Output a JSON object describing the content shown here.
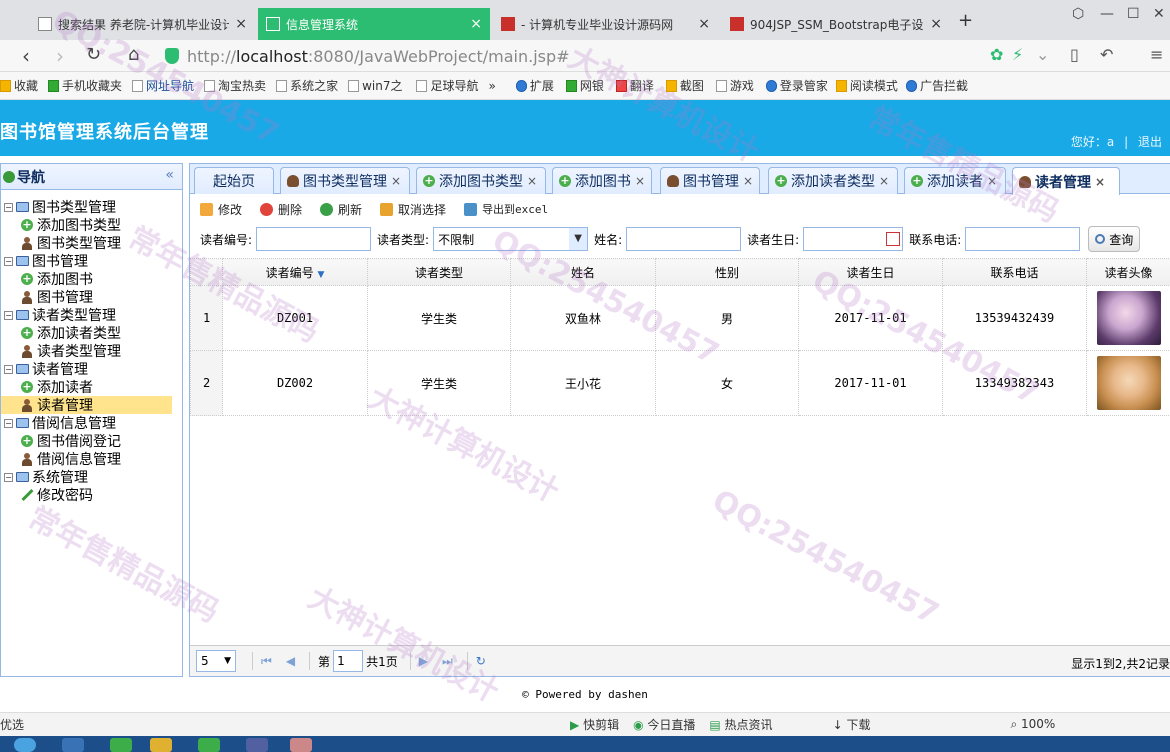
{
  "browser": {
    "tabs": [
      {
        "title": "搜索结果 养老院-计算机毕业设计"
      },
      {
        "title": "信息管理系统"
      },
      {
        "title": "- 计算机专业毕业设计源码网"
      },
      {
        "title": "904JSP_SSM_Bootstrap电子设"
      }
    ],
    "url_prefix": "http://",
    "url_host": "localhost",
    "url_rest": ":8080/JavaWebProject/main.jsp#",
    "bookmarks": [
      "收藏",
      "手机收藏夹",
      "网址导航",
      "淘宝热卖",
      "系统之家",
      "win7之",
      "足球导航",
      "»",
      "扩展",
      "网银",
      "翻译",
      "截图",
      "游戏",
      "登录管家",
      "阅读模式",
      "广告拦截"
    ],
    "status_left": "优选",
    "status_items": [
      "快剪辑",
      "今日直播",
      "热点资讯",
      "下载",
      "100%"
    ]
  },
  "app": {
    "title": "图书馆管理系统后台管理",
    "greeting": "您好：a",
    "logout": "退出"
  },
  "sidebar": {
    "title": "导航",
    "collapse": "«",
    "groups": [
      {
        "label": "图书类型管理",
        "children": [
          "添加图书类型",
          "图书类型管理"
        ]
      },
      {
        "label": "图书管理",
        "children": [
          "添加图书",
          "图书管理"
        ]
      },
      {
        "label": "读者类型管理",
        "children": [
          "添加读者类型",
          "读者类型管理"
        ]
      },
      {
        "label": "读者管理",
        "children": [
          "添加读者",
          "读者管理"
        ]
      },
      {
        "label": "借阅信息管理",
        "children": [
          "图书借阅登记",
          "借阅信息管理"
        ]
      },
      {
        "label": "系统管理",
        "children": [
          "修改密码"
        ]
      }
    ]
  },
  "tabs": [
    "起始页",
    "图书类型管理",
    "添加图书类型",
    "添加图书",
    "图书管理",
    "添加读者类型",
    "添加读者",
    "读者管理"
  ],
  "toolbar": {
    "edit": "修改",
    "delete": "删除",
    "refresh": "刷新",
    "unselect": "取消选择",
    "export": "导出到excel"
  },
  "search": {
    "reader_no_label": "读者编号:",
    "reader_type_label": "读者类型:",
    "reader_type_value": "不限制",
    "name_label": "姓名:",
    "birthday_label": "读者生日:",
    "phone_label": "联系电话:",
    "query_button": "查询"
  },
  "grid": {
    "columns": [
      "读者编号",
      "读者类型",
      "姓名",
      "性别",
      "读者生日",
      "联系电话",
      "读者头像"
    ],
    "sort_arrow": "▼",
    "rows": [
      {
        "rownum": "1",
        "no": "DZ001",
        "type": "学生类",
        "name": "双鱼林",
        "sex": "男",
        "birthday": "2017-11-01",
        "phone": "13539432439"
      },
      {
        "rownum": "2",
        "no": "DZ002",
        "type": "学生类",
        "name": "王小花",
        "sex": "女",
        "birthday": "2017-11-01",
        "phone": "13349382343"
      }
    ]
  },
  "pager": {
    "page_size": "5",
    "page_prefix": "第",
    "page_value": "1",
    "page_suffix": "共1页",
    "info": "显示1到2,共2记录"
  },
  "footer": "© Powered by dashen",
  "watermarks": [
    "QQ:254540457",
    "大神计算机设计",
    "常年售精品源码"
  ]
}
